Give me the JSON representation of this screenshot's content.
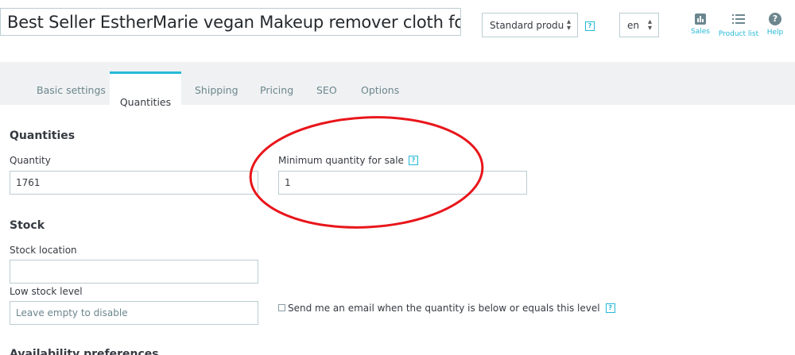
{
  "header": {
    "product_name": "Best Seller EstherMarie vegan Makeup remover cloth for face",
    "product_type": "Standard produ",
    "language": "en",
    "help_badge": "?",
    "tools": [
      {
        "label": "Sales",
        "icon": "bar-chart-icon"
      },
      {
        "label": "Product list",
        "icon": "list-icon"
      },
      {
        "label": "Help",
        "icon": "help-circle-icon"
      }
    ]
  },
  "tabs": [
    {
      "label": "Basic settings",
      "active": false
    },
    {
      "label": "Quantities",
      "active": true
    },
    {
      "label": "Shipping",
      "active": false
    },
    {
      "label": "Pricing",
      "active": false
    },
    {
      "label": "SEO",
      "active": false
    },
    {
      "label": "Options",
      "active": false
    }
  ],
  "quantities": {
    "heading": "Quantities",
    "quantity_label": "Quantity",
    "quantity_value": "1761",
    "min_label": "Minimum quantity for sale",
    "min_value": "1"
  },
  "stock": {
    "heading": "Stock",
    "location_label": "Stock location",
    "location_value": "",
    "low_label": "Low stock level",
    "low_placeholder": "Leave empty to disable",
    "email_label": "Send me an email when the quantity is below or equals this level",
    "email_checked": false
  },
  "availability": {
    "heading": "Availability preferences"
  },
  "colors": {
    "accent": "#25b9d7",
    "annotation": "#e8161b",
    "tab_bar": "#eff1f2",
    "icon_gray": "#6c868e"
  }
}
